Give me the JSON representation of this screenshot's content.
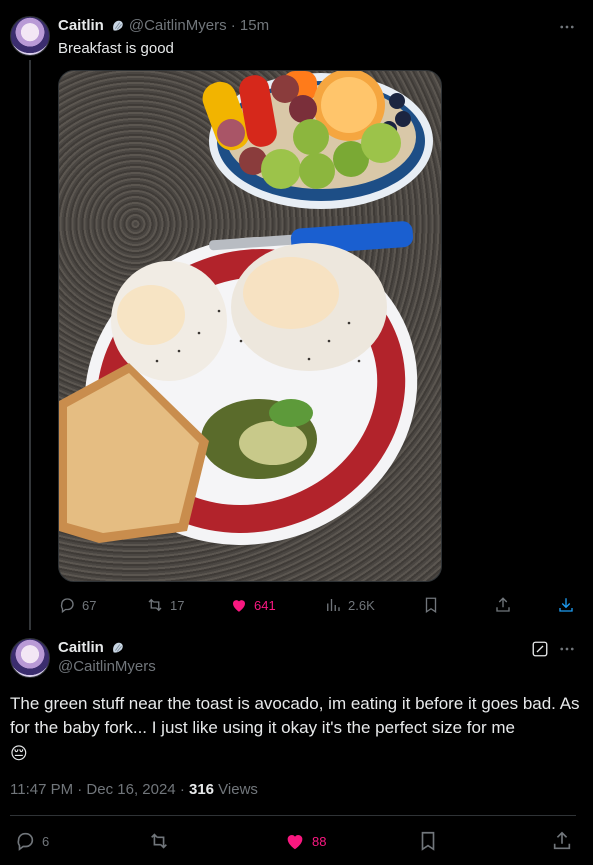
{
  "tweet1": {
    "name": "Caitlin",
    "handle_time": "@CaitlinMyers · 15m",
    "text": "Breakfast is good",
    "stats": {
      "replies": "67",
      "reposts": "17",
      "likes": "641",
      "views": "2.6K"
    }
  },
  "tweet2": {
    "name": "Caitlin",
    "handle": "@CaitlinMyers",
    "text": "The green stuff near the toast is avocado, im eating it before it goes bad. As for the baby fork... I just like using it okay it's the perfect size for me",
    "emoji": "😔",
    "timestamp": "11:47 PM · Dec 16, 2024 · ",
    "views_count": "316",
    "views_label": " Views",
    "stats": {
      "replies": "6",
      "likes": "88"
    }
  },
  "colors": {
    "background": "#000000",
    "like": "#f91880",
    "muted": "#71767b",
    "border": "#2f3336"
  },
  "icons": [
    "more-icon",
    "reply-icon",
    "repost-icon",
    "like-icon",
    "views-icon",
    "bookmark-icon",
    "share-icon",
    "download-icon",
    "grok-icon",
    "verified-shell-icon"
  ]
}
